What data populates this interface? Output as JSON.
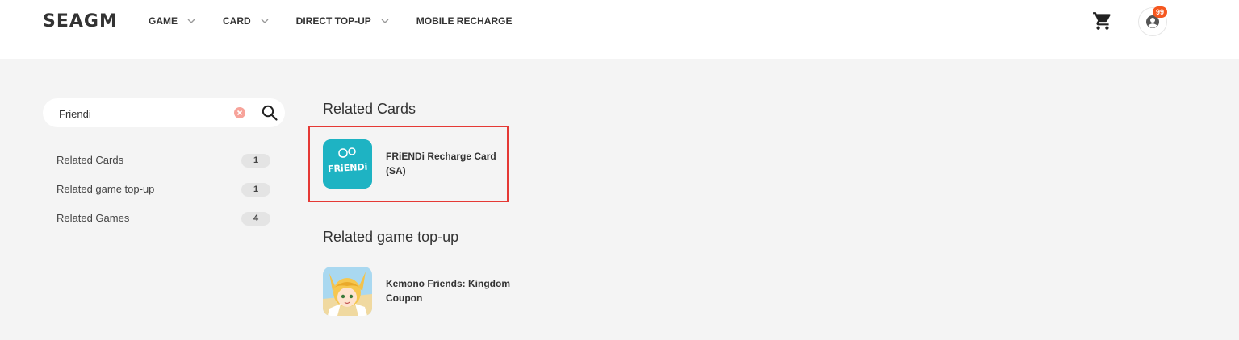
{
  "header": {
    "logo": "SEAGM",
    "nav": [
      {
        "label": "GAME",
        "has_dropdown": true
      },
      {
        "label": "CARD",
        "has_dropdown": true
      },
      {
        "label": "DIRECT TOP-UP",
        "has_dropdown": true
      },
      {
        "label": "MOBILE RECHARGE",
        "has_dropdown": false
      }
    ],
    "cart_icon": "cart-icon",
    "account_icon": "user-circle-icon",
    "notification_count": "99"
  },
  "search": {
    "value": "Friendi",
    "placeholder": "",
    "clear_icon": "clear-circle-icon",
    "search_icon": "search-icon"
  },
  "sidebar": {
    "items": [
      {
        "label": "Related Cards",
        "count": "1"
      },
      {
        "label": "Related game top-up",
        "count": "1"
      },
      {
        "label": "Related Games",
        "count": "4"
      }
    ]
  },
  "results": {
    "cards": {
      "title": "Related Cards",
      "items": [
        {
          "name": "FRiENDi Recharge Card (SA)",
          "logo_text": "FRiENDi",
          "bg": "#1eb3c3"
        }
      ]
    },
    "topup": {
      "title": "Related game top-up",
      "items": [
        {
          "name": "Kemono Friends: Kingdom Coupon"
        }
      ]
    }
  },
  "colors": {
    "accent": "#f5571f",
    "highlight_border": "#e53935",
    "page_bg": "#f4f4f4"
  }
}
